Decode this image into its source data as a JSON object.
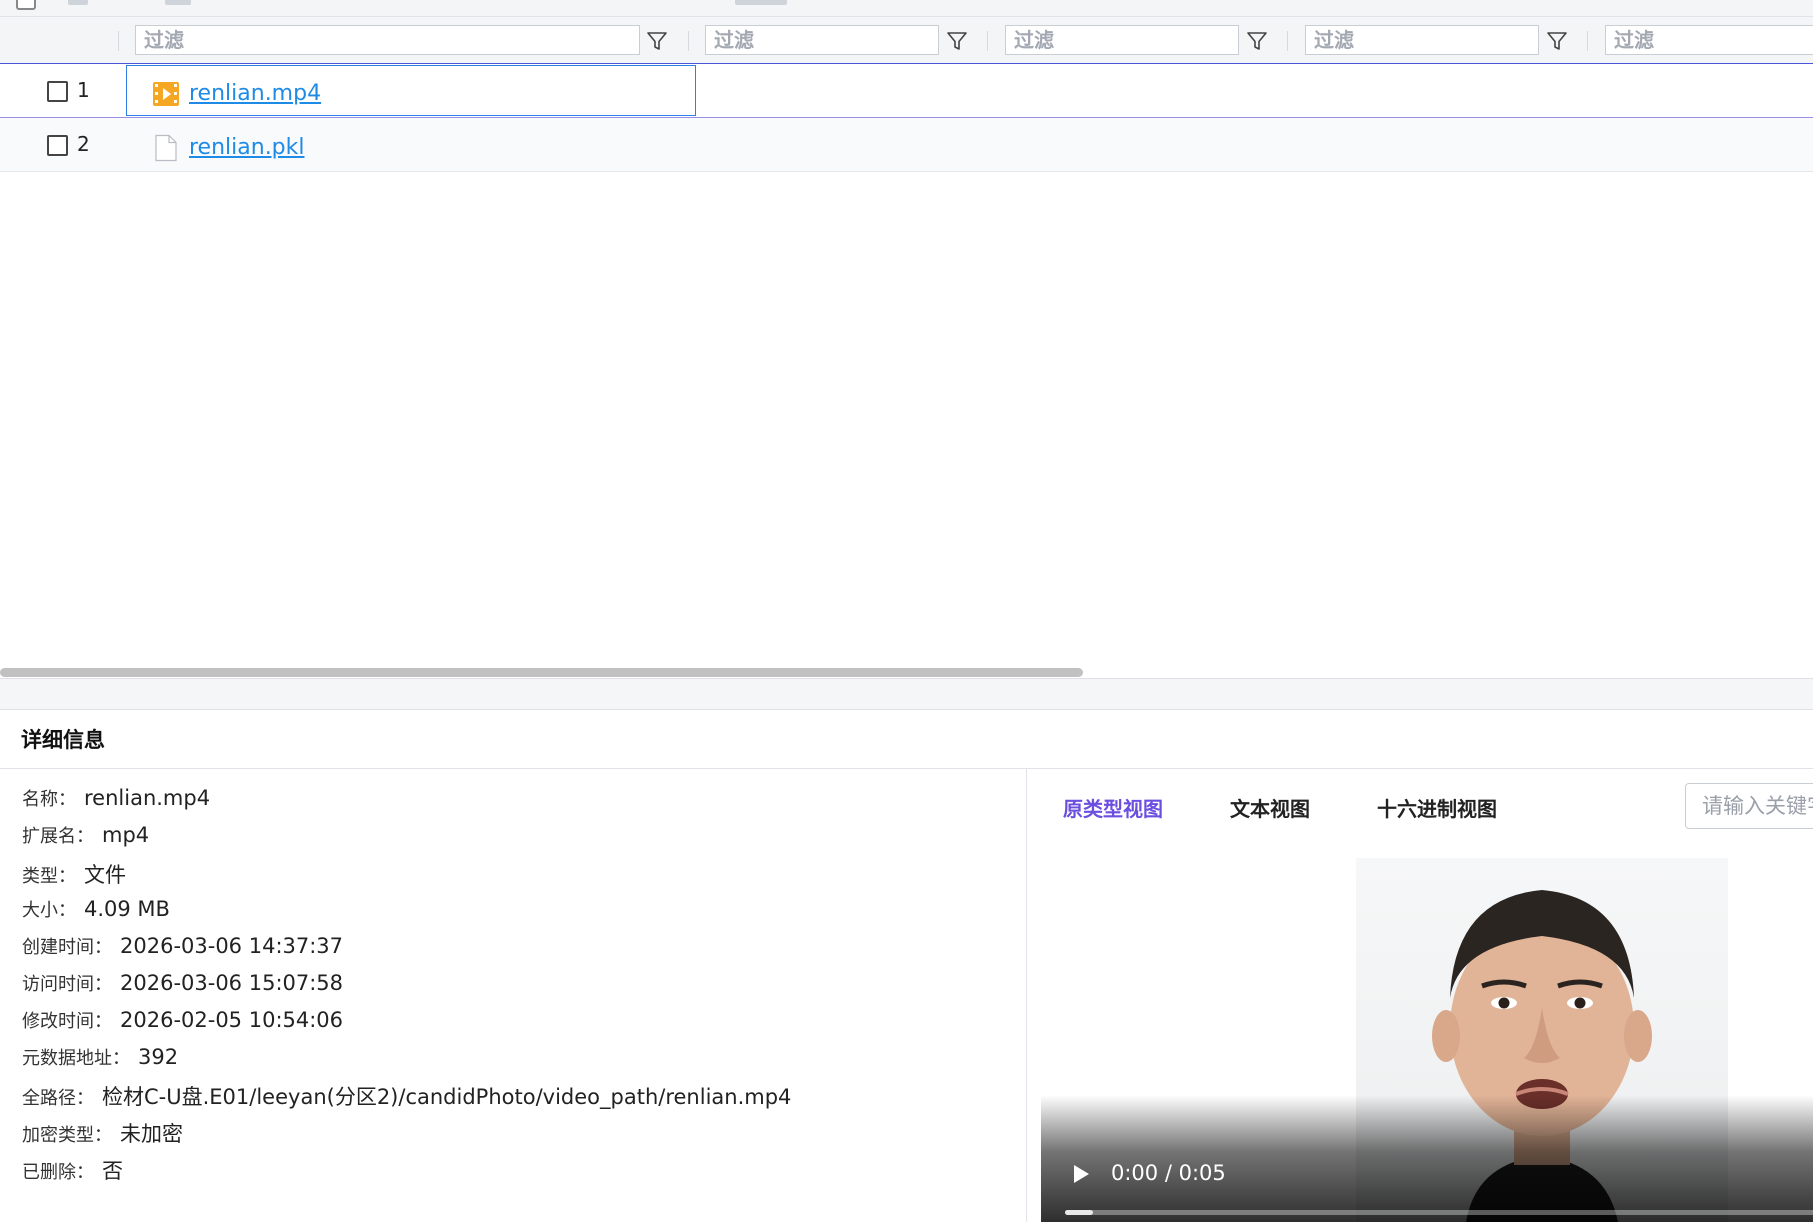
{
  "filters": {
    "placeholder": "过滤",
    "columns": [
      {
        "value": ""
      },
      {
        "value": ""
      },
      {
        "value": ""
      },
      {
        "value": ""
      },
      {
        "value": ""
      }
    ]
  },
  "files": [
    {
      "index": "1",
      "name": "renlian.mp4",
      "icon": "video-file-icon",
      "selected": true
    },
    {
      "index": "2",
      "name": "renlian.pkl",
      "icon": "generic-file-icon",
      "selected": false
    }
  ],
  "detail": {
    "title": "详细信息",
    "fields": [
      {
        "label": "名称：",
        "value": "renlian.mp4"
      },
      {
        "label": "扩展名：",
        "value": "mp4"
      },
      {
        "label": "类型：",
        "value": "文件"
      },
      {
        "label": "大小：",
        "value": "4.09 MB"
      },
      {
        "label": "创建时间：",
        "value": "2026-03-06 14:37:37"
      },
      {
        "label": "访问时间：",
        "value": "2026-03-06 15:07:58"
      },
      {
        "label": "修改时间：",
        "value": "2026-02-05 10:54:06"
      },
      {
        "label": "元数据地址：",
        "value": "392"
      },
      {
        "label": "全路径：",
        "value": "检材C-U盘.E01/leeyan(分区2)/candidPhoto/video_path/renlian.mp4"
      },
      {
        "label": "加密类型：",
        "value": "未加密"
      },
      {
        "label": "已删除：",
        "value": "否"
      }
    ]
  },
  "preview": {
    "tabs": [
      {
        "label": "原类型视图",
        "active": true
      },
      {
        "label": "文本视图",
        "active": false
      },
      {
        "label": "十六进制视图",
        "active": false
      }
    ],
    "search_placeholder": "请输入关键字",
    "video": {
      "time_display": "0:00 / 0:05",
      "progress_fraction": 0.0
    }
  },
  "colors": {
    "accent": "#6b4fe0",
    "link": "#1e8be6",
    "selection_border": "#2f7fe4",
    "video_icon": "#f5a623"
  }
}
